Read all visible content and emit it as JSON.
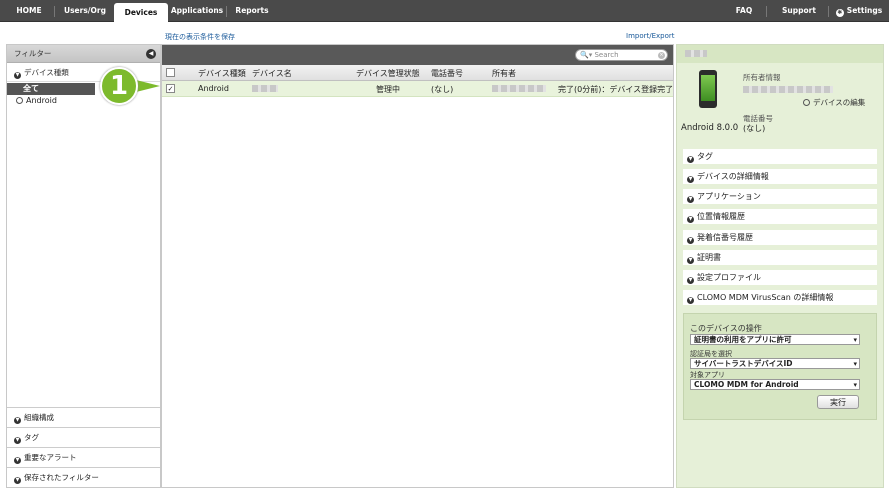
{
  "nav": {
    "tabs": [
      "HOME",
      "Users/Org",
      "Devices",
      "Applications",
      "Reports"
    ],
    "right": [
      "FAQ",
      "Support",
      "Settings"
    ]
  },
  "links": {
    "save_view": "現在の表示条件を保存",
    "import_export": "Import/Export"
  },
  "filter": {
    "header": "フィルター",
    "device_type_section": "デバイス種類",
    "items": [
      "全て",
      "Android"
    ],
    "bottom_sections": [
      "組織構成",
      "タグ",
      "重要なアラート",
      "保存されたフィルター"
    ]
  },
  "grid": {
    "search_placeholder": "Search",
    "columns": [
      "デバイス種類",
      "デバイス名",
      "デバイス管理状態",
      "電話番号",
      "所有者"
    ],
    "rows": [
      {
        "type": "Android",
        "status": "管理中",
        "phone": "(なし)",
        "note": "完了(0分前)：デバイス登録完了"
      }
    ]
  },
  "annotation": {
    "number": "1"
  },
  "device": {
    "os": "Android 8.0.0",
    "owner_label": "所有者情報",
    "edit_link": "デバイスの編集",
    "phone_label": "電話番号",
    "phone_value": "(なし)"
  },
  "sections": [
    "タグ",
    "デバイスの詳細情報",
    "アプリケーション",
    "位置情報履歴",
    "発着信番号履歴",
    "証明書",
    "設定プロファイル",
    "CLOMO MDM VirusScan の詳細情報"
  ],
  "operations": {
    "title": "このデバイスの操作",
    "action": "証明書の利用をアプリに許可",
    "ca_label": "認証局を選択",
    "ca_value": "サイバートラストデバイスID",
    "app_label": "対象アプリ",
    "app_value": "CLOMO MDM for Android",
    "run": "実行"
  }
}
